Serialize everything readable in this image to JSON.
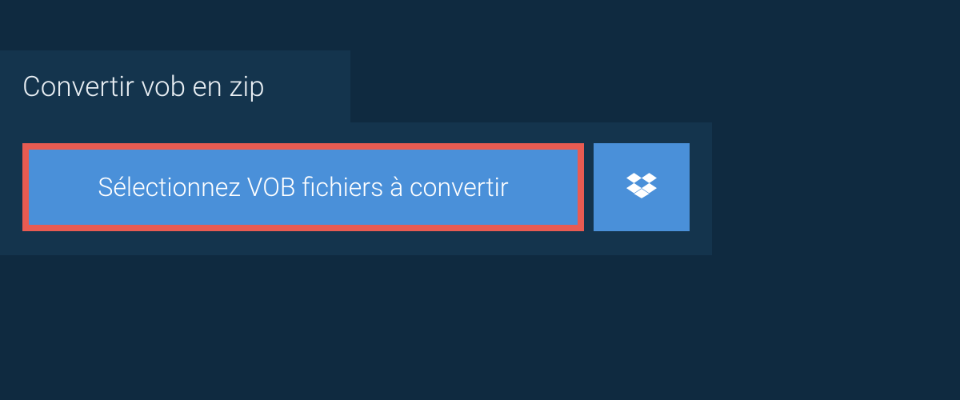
{
  "tab": {
    "label": "Convertir vob en zip"
  },
  "upload": {
    "select_label": "Sélectionnez VOB fichiers à convertir"
  },
  "colors": {
    "background": "#0f2a40",
    "panel": "#14344d",
    "button": "#4a90d9",
    "highlight_border": "#e85b52",
    "text_light": "#e8eef3"
  }
}
